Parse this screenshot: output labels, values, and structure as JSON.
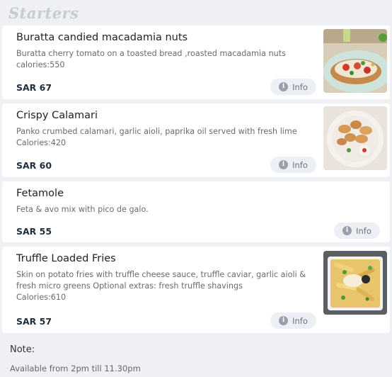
{
  "section": {
    "title": "Starters"
  },
  "items": [
    {
      "name": "Buratta candied macadamia nuts",
      "description": "Buratta cherry tomato on a toasted bread ,roasted macadamia nuts",
      "calories": "calories:550",
      "price": "SAR 67",
      "info_label": "Info",
      "image_icon": "buratta-toast-photo"
    },
    {
      "name": "Crispy Calamari",
      "description": "Panko crumbed calamari, garlic aioli, paprika oil served with fresh lime",
      "calories": "Calories:420",
      "price": "SAR 60",
      "info_label": "Info",
      "image_icon": "calamari-bowl-photo"
    },
    {
      "name": "Fetamole",
      "description": "Feta & avo mix with pico de galo.",
      "price": "SAR 55",
      "info_label": "Info"
    },
    {
      "name": "Truffle Loaded Fries",
      "description": "Skin on potato fries with truffle cheese sauce, truffle caviar, garlic aioli & fresh micro greens Optional extras: fresh truffle shavings",
      "calories": "Calories:610",
      "price": "SAR 57",
      "info_label": "Info",
      "image_icon": "truffle-fries-photo"
    }
  ],
  "note": {
    "label": "Note:",
    "text": "Available from 2pm till 11.30pm"
  },
  "colors": {
    "background": "#eef0f3",
    "card": "#ffffff",
    "price": "#1f2d3d",
    "info_button": "#eceff3",
    "section_title": "#c7ccd3"
  }
}
